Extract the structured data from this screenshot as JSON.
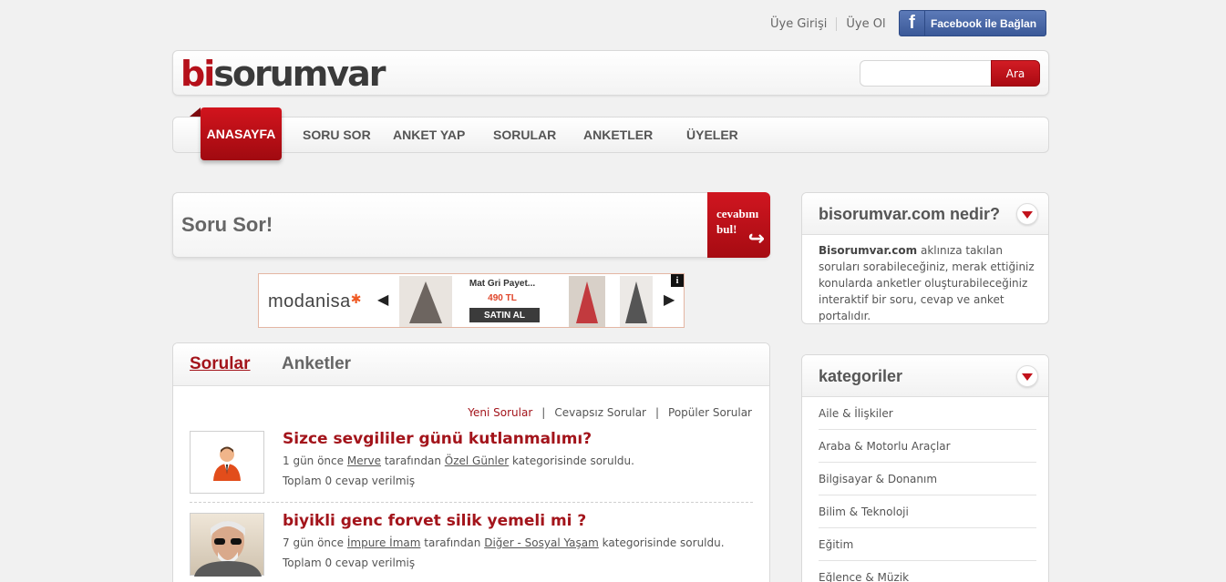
{
  "top": {
    "login": "Üye Girişi",
    "register": "Üye Ol",
    "facebook": "Facebook ile Bağlan",
    "facebook_icon": "f"
  },
  "header": {
    "logo_bi": "bi",
    "logo_rest": "sorumvar",
    "search_button": "Ara",
    "search_value": ""
  },
  "nav": {
    "active": "ANASAYFA",
    "items": [
      "SORU SOR",
      "ANKET YAP",
      "SORULAR",
      "ANKETLER",
      "ÜYELER"
    ]
  },
  "ask": {
    "title": "Soru Sor!",
    "cta_line1": "cevabını",
    "cta_line2": "bul!"
  },
  "ad": {
    "brand": "modanisa",
    "product_name": "Mat Gri Payet...",
    "price": "490 TL",
    "buy": "SATIN AL",
    "info": "i"
  },
  "questions": {
    "tabs": [
      "Sorular",
      "Anketler"
    ],
    "filters": [
      "Yeni Sorular",
      "Cevapsız Sorular",
      "Popüler Sorular"
    ],
    "items": [
      {
        "title": "Sizce sevgililer günü kutlanmalımı?",
        "time": "1 gün önce",
        "user": "Merve",
        "by": "tarafından",
        "category": "Özel Günler",
        "suffix": "kategorisinde soruldu.",
        "count": "Toplam 0 cevap verilmiş"
      },
      {
        "title": "biyikli genc forvet silik yemeli mi ?",
        "time": "7 gün önce",
        "user": "İmpure İmam",
        "by": "tarafından",
        "category": "Diğer - Sosyal Yaşam",
        "suffix": "kategorisinde soruldu.",
        "count": "Toplam 0 cevap verilmiş"
      }
    ]
  },
  "sidebar": {
    "about_title": "bisorumvar.com nedir?",
    "about_brand": "Bisorumvar.com",
    "about_text": " aklınıza takılan soruları sorabileceğiniz, merak ettiğiniz konularda anketler oluşturabileceğiniz interaktif bir soru, cevap ve anket portalıdır.",
    "categories_title": "kategoriler",
    "categories": [
      "Aile & İlişkiler",
      "Araba & Motorlu Araçlar",
      "Bilgisayar & Donanım",
      "Bilim & Teknoloji",
      "Eğitim",
      "Eğlence & Müzik"
    ]
  },
  "colors": {
    "brand_red": "#b5101a",
    "link_red": "#a3141b",
    "facebook_blue": "#3b5998"
  }
}
